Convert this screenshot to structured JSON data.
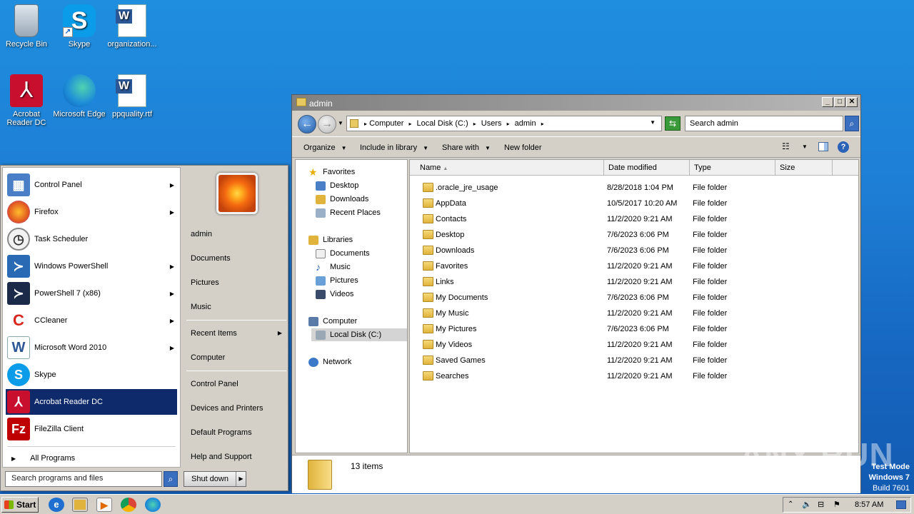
{
  "desktop": {
    "icons": [
      {
        "label": "Recycle Bin"
      },
      {
        "label": "Skype"
      },
      {
        "label": "organization..."
      },
      {
        "label": "Acrobat Reader DC"
      },
      {
        "label": "Microsoft Edge"
      },
      {
        "label": "ppquality.rtf"
      }
    ]
  },
  "start_menu": {
    "programs": [
      {
        "label": "Control Panel",
        "icon": "control-panel-icon"
      },
      {
        "label": "Firefox",
        "icon": "firefox-icon"
      },
      {
        "label": "Task Scheduler",
        "icon": "task-scheduler-icon"
      },
      {
        "label": "Windows PowerShell",
        "icon": "powershell-icon"
      },
      {
        "label": "PowerShell 7 (x86)",
        "icon": "powershell7-icon"
      },
      {
        "label": "CCleaner",
        "icon": "ccleaner-icon"
      },
      {
        "label": "Microsoft Word 2010",
        "icon": "word-icon"
      },
      {
        "label": "Skype",
        "icon": "skype-icon"
      },
      {
        "label": "Acrobat Reader DC",
        "icon": "acrobat-icon"
      },
      {
        "label": "FileZilla Client",
        "icon": "filezilla-icon"
      }
    ],
    "all_programs": "All Programs",
    "search_placeholder": "Search programs and files",
    "right_items": [
      "admin",
      "Documents",
      "Pictures",
      "Music",
      "Recent Items",
      "Computer",
      "Control Panel",
      "Devices and Printers",
      "Default Programs",
      "Help and Support"
    ],
    "shutdown": "Shut down"
  },
  "explorer": {
    "title": "admin",
    "breadcrumb": [
      "Computer",
      "Local Disk (C:)",
      "Users",
      "admin"
    ],
    "search_placeholder": "Search admin",
    "toolbar": {
      "organize": "Organize",
      "include": "Include in library",
      "share": "Share with",
      "new_folder": "New folder"
    },
    "nav": {
      "favorites": "Favorites",
      "desktop": "Desktop",
      "downloads": "Downloads",
      "recent": "Recent Places",
      "libraries": "Libraries",
      "documents": "Documents",
      "music": "Music",
      "pictures": "Pictures",
      "videos": "Videos",
      "computer": "Computer",
      "local_disk": "Local Disk (C:)",
      "network": "Network"
    },
    "columns": [
      "Name",
      "Date modified",
      "Type",
      "Size"
    ],
    "files": [
      {
        "name": ".oracle_jre_usage",
        "date": "8/28/2018 1:04 PM",
        "type": "File folder"
      },
      {
        "name": "AppData",
        "date": "10/5/2017 10:20 AM",
        "type": "File folder"
      },
      {
        "name": "Contacts",
        "date": "11/2/2020 9:21 AM",
        "type": "File folder"
      },
      {
        "name": "Desktop",
        "date": "7/6/2023 6:06 PM",
        "type": "File folder"
      },
      {
        "name": "Downloads",
        "date": "7/6/2023 6:06 PM",
        "type": "File folder"
      },
      {
        "name": "Favorites",
        "date": "11/2/2020 9:21 AM",
        "type": "File folder"
      },
      {
        "name": "Links",
        "date": "11/2/2020 9:21 AM",
        "type": "File folder"
      },
      {
        "name": "My Documents",
        "date": "7/6/2023 6:06 PM",
        "type": "File folder"
      },
      {
        "name": "My Music",
        "date": "11/2/2020 9:21 AM",
        "type": "File folder"
      },
      {
        "name": "My Pictures",
        "date": "7/6/2023 6:06 PM",
        "type": "File folder"
      },
      {
        "name": "My Videos",
        "date": "11/2/2020 9:21 AM",
        "type": "File folder"
      },
      {
        "name": "Saved Games",
        "date": "11/2/2020 9:21 AM",
        "type": "File folder"
      },
      {
        "name": "Searches",
        "date": "11/2/2020 9:21 AM",
        "type": "File folder"
      }
    ],
    "item_count": "13 items"
  },
  "watermark": "ANY RUN",
  "test_mode": {
    "line1": "Test Mode",
    "line2": "Windows 7",
    "line3": "Build 7601"
  },
  "taskbar": {
    "start": "Start",
    "clock": "8:57 AM"
  }
}
